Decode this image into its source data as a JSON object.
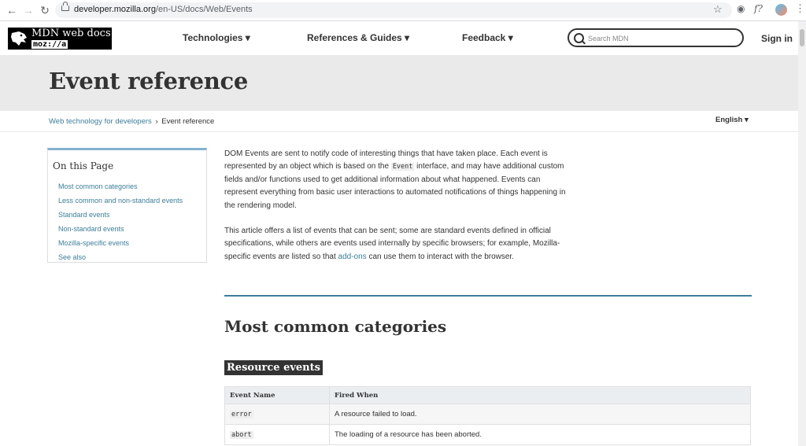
{
  "browser": {
    "url_host": "developer.mozilla.org",
    "url_path": "/en-US/docs/Web/Events"
  },
  "header": {
    "logo_title": "MDN web docs",
    "logo_sub": "moz://a",
    "menu": [
      {
        "label": "Technologies ▾"
      },
      {
        "label": "References & Guides ▾"
      },
      {
        "label": "Feedback ▾"
      }
    ],
    "search_placeholder": "Search MDN",
    "signin": "Sign in"
  },
  "page": {
    "title": "Event reference"
  },
  "breadcrumb": {
    "parent": "Web technology for developers",
    "separator": "›",
    "current": "Event reference"
  },
  "language": "English ▾",
  "toc": {
    "title": "On this Page",
    "items": [
      "Most common categories",
      "Less common and non-standard events",
      "Standard events",
      "Non-standard events",
      "Mozilla-specific events",
      "See also"
    ]
  },
  "article": {
    "p1_a": "DOM Events are sent to notify code of interesting things that have taken place. Each event is represented by an object which is based on the ",
    "p1_code": "Event",
    "p1_b": " interface, and may have additional custom fields and/or functions used to get additional information about what happened. Events can represent everything from basic user interactions to automated notifications of things happening in the rendering model.",
    "p2_a": "This article offers a list of events that can be sent; some are standard events defined in official specifications, while others are events used internally by specific browsers; for example, Mozilla-specific events are listed so that ",
    "p2_link": "add-ons",
    "p2_b": " can use them to interact with the browser.",
    "section_heading": "Most common categories",
    "subsection_heading": "Resource events"
  },
  "table": {
    "headers": [
      "Event Name",
      "Fired When"
    ],
    "rows": [
      {
        "name": "error",
        "desc": "A resource failed to load."
      },
      {
        "name": "abort",
        "desc": "The loading of a resource has been aborted."
      }
    ]
  }
}
